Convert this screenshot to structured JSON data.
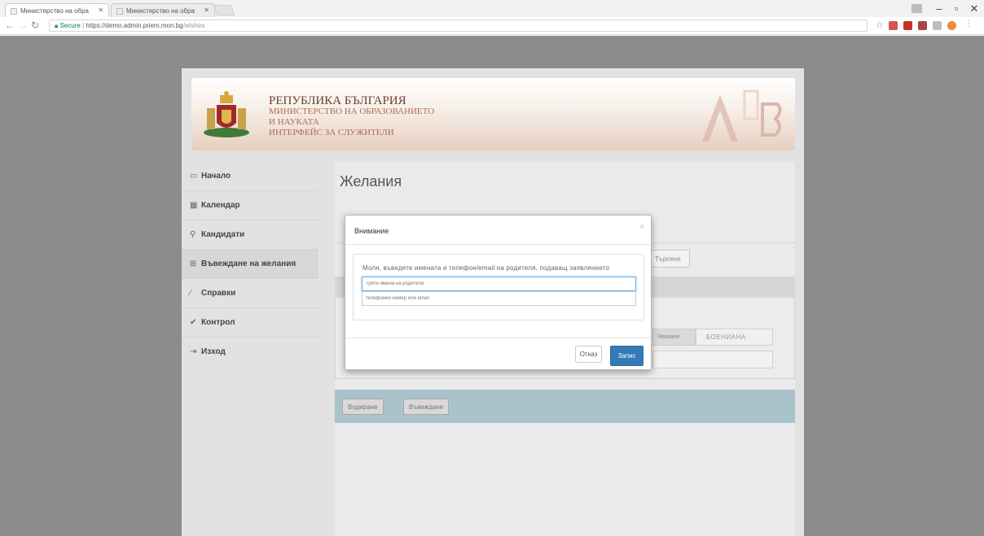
{
  "browser": {
    "tabs": [
      {
        "title": "Министерство на обра"
      },
      {
        "title": "Министерство на обра"
      }
    ],
    "url_secure": "Secure",
    "url_host": "https://demo.admin.priem.mon.bg",
    "url_path": "/wishes"
  },
  "header": {
    "line1": "РЕПУБЛИКА БЪЛГАРИЯ",
    "line2": "МИНИСТЕРСТВО НА ОБРАЗОВАНИЕТО",
    "line3": "И НАУКАТА",
    "line4": "ИНТЕРФЕЙС ЗА СЛУЖИТЕЛИ",
    "logo_text": "ABB"
  },
  "sidebar": {
    "items": [
      {
        "label": "Начало",
        "icon": "monitor-icon"
      },
      {
        "label": "Календар",
        "icon": "calendar-icon"
      },
      {
        "label": "Кандидати",
        "icon": "search-icon"
      },
      {
        "label": "Въвеждане на желания",
        "icon": "grid-icon"
      },
      {
        "label": "Справки",
        "icon": "chart-icon"
      },
      {
        "label": "Контрол",
        "icon": "check-icon"
      },
      {
        "label": "Изход",
        "icon": "logout-icon"
      }
    ]
  },
  "main": {
    "title": "Желания",
    "search_button": "Търсене",
    "column_label": "Явяване",
    "column_value": "БОЕНИАНА",
    "actions": {
      "delete": "Водиране",
      "enter": "Въвеждане"
    }
  },
  "modal": {
    "title": "Внимание",
    "close": "×",
    "message": "Моля, въведете имената и телефон/email на родителя, подаващ заявлението",
    "name_placeholder": "Трите имена на родителя",
    "contact_placeholder": "телефонен номер или email",
    "cancel": "Отказ",
    "save": "Запис"
  },
  "colors": {
    "primary": "#337ab7",
    "overlay": "#8c8c8c",
    "header_brown": "#b06a4f"
  }
}
